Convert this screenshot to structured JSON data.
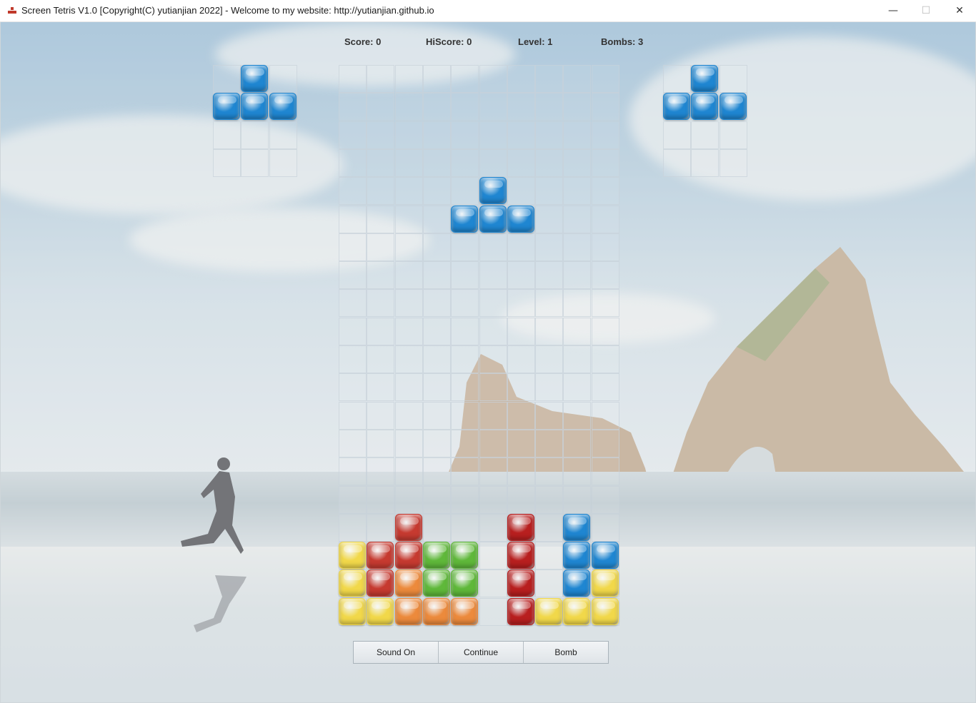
{
  "window": {
    "title": "Screen Tetris V1.0 [Copyright(C) yutianjian 2022] - Welcome to my website: http://yutianjian.github.io",
    "minimize_glyph": "—",
    "maximize_glyph": "☐",
    "close_glyph": "✕",
    "icon": "tetris-app-icon"
  },
  "hud": {
    "score": "Score: 0",
    "hiscore": "HiScore: 0",
    "level": "Level: 1",
    "bombs": "Bombs: 3"
  },
  "colors": {
    "blue": "#1f86d1",
    "red": "#c63a30",
    "yellow": "#f1d84a",
    "green": "#5fb83a",
    "orange": "#ec8a3c",
    "dark_red": "#b81f1f"
  },
  "board": {
    "cols": 10,
    "rows": 20,
    "falling_piece": {
      "shape": "T",
      "color": "blue",
      "cells": [
        [
          5,
          5
        ],
        [
          4,
          6
        ],
        [
          5,
          6
        ],
        [
          6,
          6
        ]
      ]
    },
    "settled": [
      {
        "col": 2,
        "row": 17,
        "color": "red"
      },
      {
        "col": 6,
        "row": 17,
        "color": "dark_red"
      },
      {
        "col": 8,
        "row": 17,
        "color": "blue"
      },
      {
        "col": 0,
        "row": 18,
        "color": "yellow"
      },
      {
        "col": 1,
        "row": 18,
        "color": "red"
      },
      {
        "col": 2,
        "row": 18,
        "color": "red"
      },
      {
        "col": 3,
        "row": 18,
        "color": "green"
      },
      {
        "col": 4,
        "row": 18,
        "color": "green"
      },
      {
        "col": 6,
        "row": 18,
        "color": "dark_red"
      },
      {
        "col": 8,
        "row": 18,
        "color": "blue"
      },
      {
        "col": 9,
        "row": 18,
        "color": "blue"
      },
      {
        "col": 0,
        "row": 19,
        "color": "yellow"
      },
      {
        "col": 1,
        "row": 19,
        "color": "red"
      },
      {
        "col": 2,
        "row": 19,
        "color": "orange"
      },
      {
        "col": 3,
        "row": 19,
        "color": "green"
      },
      {
        "col": 4,
        "row": 19,
        "color": "green"
      },
      {
        "col": 6,
        "row": 19,
        "color": "dark_red"
      },
      {
        "col": 8,
        "row": 19,
        "color": "blue"
      },
      {
        "col": 9,
        "row": 19,
        "color": "yellow"
      },
      {
        "col": 0,
        "row": 20,
        "color": "yellow"
      },
      {
        "col": 1,
        "row": 20,
        "color": "yellow"
      },
      {
        "col": 2,
        "row": 20,
        "color": "orange"
      },
      {
        "col": 3,
        "row": 20,
        "color": "orange"
      },
      {
        "col": 4,
        "row": 20,
        "color": "orange"
      },
      {
        "col": 6,
        "row": 20,
        "color": "dark_red"
      },
      {
        "col": 7,
        "row": 20,
        "color": "yellow"
      },
      {
        "col": 8,
        "row": 20,
        "color": "yellow"
      },
      {
        "col": 9,
        "row": 20,
        "color": "yellow"
      }
    ]
  },
  "preview_left": {
    "cols": 3,
    "rows": 4,
    "color": "blue",
    "cells": [
      [
        1,
        0
      ],
      [
        0,
        1
      ],
      [
        1,
        1
      ],
      [
        2,
        1
      ]
    ]
  },
  "preview_right": {
    "cols": 3,
    "rows": 4,
    "color": "blue",
    "cells": [
      [
        1,
        0
      ],
      [
        0,
        1
      ],
      [
        1,
        1
      ],
      [
        2,
        1
      ]
    ]
  },
  "buttons": {
    "sound": "Sound On",
    "continue": "Continue",
    "bomb": "Bomb"
  }
}
